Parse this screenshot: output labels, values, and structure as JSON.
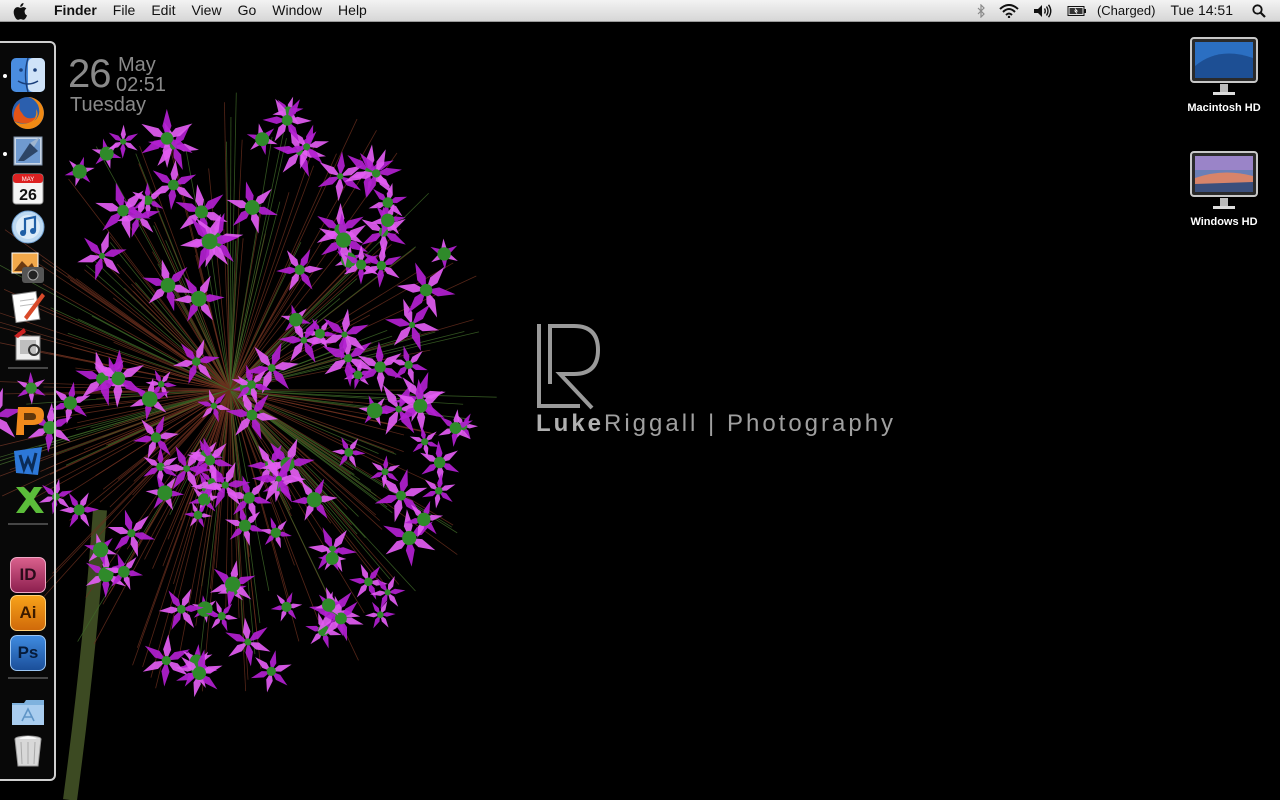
{
  "menubar": {
    "apple_icon": "apple-icon",
    "app_name": "Finder",
    "menus": [
      "File",
      "Edit",
      "View",
      "Go",
      "Window",
      "Help"
    ],
    "status": {
      "bluetooth_icon": "bluetooth-icon",
      "wifi_icon": "wifi-icon",
      "volume_icon": "volume-icon",
      "battery_icon": "battery-icon",
      "battery_text": "(Charged)",
      "clock": "Tue 14:51",
      "spotlight_icon": "spotlight-search-icon"
    }
  },
  "clock_widget": {
    "day": "26",
    "month": "May",
    "time": "02:51",
    "weekday": "Tuesday"
  },
  "dock": {
    "items": [
      {
        "name": "Finder",
        "icon": "finder-icon",
        "running": true
      },
      {
        "name": "Firefox",
        "icon": "firefox-icon",
        "running": false
      },
      {
        "name": "Mail",
        "icon": "mail-icon",
        "running": true
      },
      {
        "name": "iCal",
        "icon": "ical-icon",
        "running": false,
        "badge_month": "MAY",
        "badge_day": "26"
      },
      {
        "name": "iTunes",
        "icon": "itunes-icon",
        "running": false
      },
      {
        "name": "iPhoto",
        "icon": "iphoto-icon",
        "running": false
      },
      {
        "name": "TextEdit",
        "icon": "textedit-icon",
        "running": false
      },
      {
        "name": "Preview",
        "icon": "preview-icon",
        "running": false
      },
      {
        "name": "PowerPoint",
        "icon": "powerpoint-icon",
        "running": false
      },
      {
        "name": "Word",
        "icon": "word-icon",
        "running": false
      },
      {
        "name": "Excel",
        "icon": "excel-icon",
        "running": false
      },
      {
        "name": "InDesign",
        "icon": "indesign-icon",
        "running": false,
        "glyph": "ID"
      },
      {
        "name": "Illustrator",
        "icon": "illustrator-icon",
        "running": false,
        "glyph": "Ai"
      },
      {
        "name": "Photoshop",
        "icon": "photoshop-icon",
        "running": false,
        "glyph": "Ps"
      },
      {
        "name": "Applications",
        "icon": "applications-folder-icon",
        "running": false
      },
      {
        "name": "Trash",
        "icon": "trash-icon",
        "running": false
      }
    ]
  },
  "desktop_icons": [
    {
      "label": "Macintosh HD",
      "icon": "macintosh-hd-icon"
    },
    {
      "label": "Windows HD",
      "icon": "windows-hd-icon"
    }
  ],
  "wallpaper": {
    "logo_text": "LukeRiggall | Photography",
    "logo_first": "Luke",
    "logo_rest": "Riggall | Photography",
    "colors": {
      "petal": "#b21fd0",
      "petal_light": "#e25cf2",
      "bud": "#2f8a2a",
      "background": "#000000"
    }
  }
}
